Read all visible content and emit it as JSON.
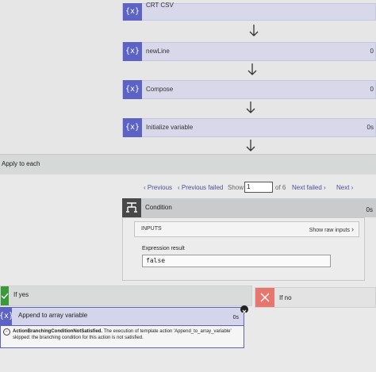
{
  "steps": [
    {
      "label": "CRT CSV",
      "icon": "{x}",
      "duration": ""
    },
    {
      "label": "newLine",
      "icon": "{x}",
      "duration": "0"
    },
    {
      "label": "Compose",
      "icon": "{x}",
      "duration": "0"
    },
    {
      "label": "Initialize variable",
      "icon": "{x}",
      "duration": "0s"
    }
  ],
  "apply_to_each": {
    "label": "Apply to each"
  },
  "pager": {
    "previous": "Previous",
    "previous_failed": "Previous failed",
    "show": "Show",
    "current": "1",
    "of_total": "of 6",
    "next_failed": "Next failed",
    "next": "Next"
  },
  "condition": {
    "label": "Condition",
    "duration": "0s",
    "inputs_label": "INPUTS",
    "show_raw": "Show raw inputs",
    "expression_label": "Expression result",
    "expression_value": "false"
  },
  "branches": {
    "yes_label": "If yes",
    "no_label": "If no"
  },
  "append": {
    "label": "Append to array variable",
    "icon": "{x}",
    "duration": "0s",
    "error_title": "ActionBranchingConditionNotSatisfied.",
    "error_text": "The execution of template action 'Append_to_array_variable' skipped: the branching condition for this action is not satisfied."
  },
  "colors": {
    "variable_accent": "#5c63c4",
    "condition_dark": "#484848",
    "yes_green": "#3a9a3a",
    "no_red": "#e7776e",
    "link_blue": "#4a4f9c"
  }
}
